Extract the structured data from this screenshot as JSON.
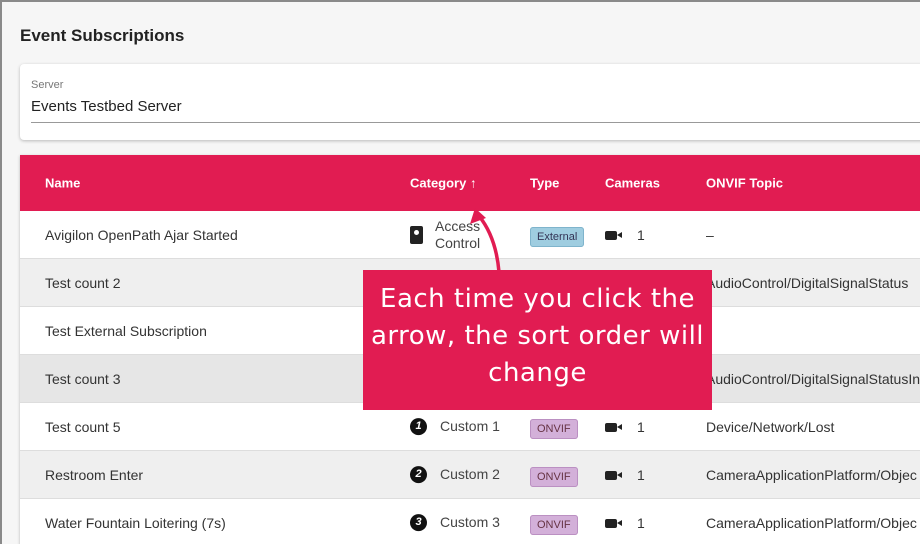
{
  "title": "Event Subscriptions",
  "server": {
    "label": "Server",
    "value": "Events Testbed Server"
  },
  "columns": [
    "Name",
    "Category ↑",
    "Type",
    "Cameras",
    "ONVIF Topic"
  ],
  "rows": [
    {
      "name": "Avigilon OpenPath Ajar Started",
      "category": "Access Control",
      "type": "External",
      "cameras": "1",
      "topic": "–"
    },
    {
      "name": "Test count 2",
      "topic": "AudioControl/DigitalSignalStatus"
    },
    {
      "name": "Test External Subscription",
      "topic": ""
    },
    {
      "name": "Test count 3",
      "topic": "AudioControl/DigitalSignalStatusIn"
    },
    {
      "name": "Test count 5",
      "num": "1",
      "category": "Custom 1",
      "type": "ONVIF",
      "cameras": "1",
      "topic": "Device/Network/Lost"
    },
    {
      "name": "Restroom Enter",
      "num": "2",
      "category": "Custom 2",
      "type": "ONVIF",
      "cameras": "1",
      "topic": "CameraApplicationPlatform/Objec"
    },
    {
      "name": "Water Fountain Loitering (7s)",
      "num": "3",
      "category": "Custom 3",
      "type": "ONVIF",
      "cameras": "1",
      "topic": "CameraApplicationPlatform/Objec"
    }
  ],
  "callout": "Each time you click the arrow, the sort order will change",
  "colors": {
    "accent": "#e11c52"
  }
}
